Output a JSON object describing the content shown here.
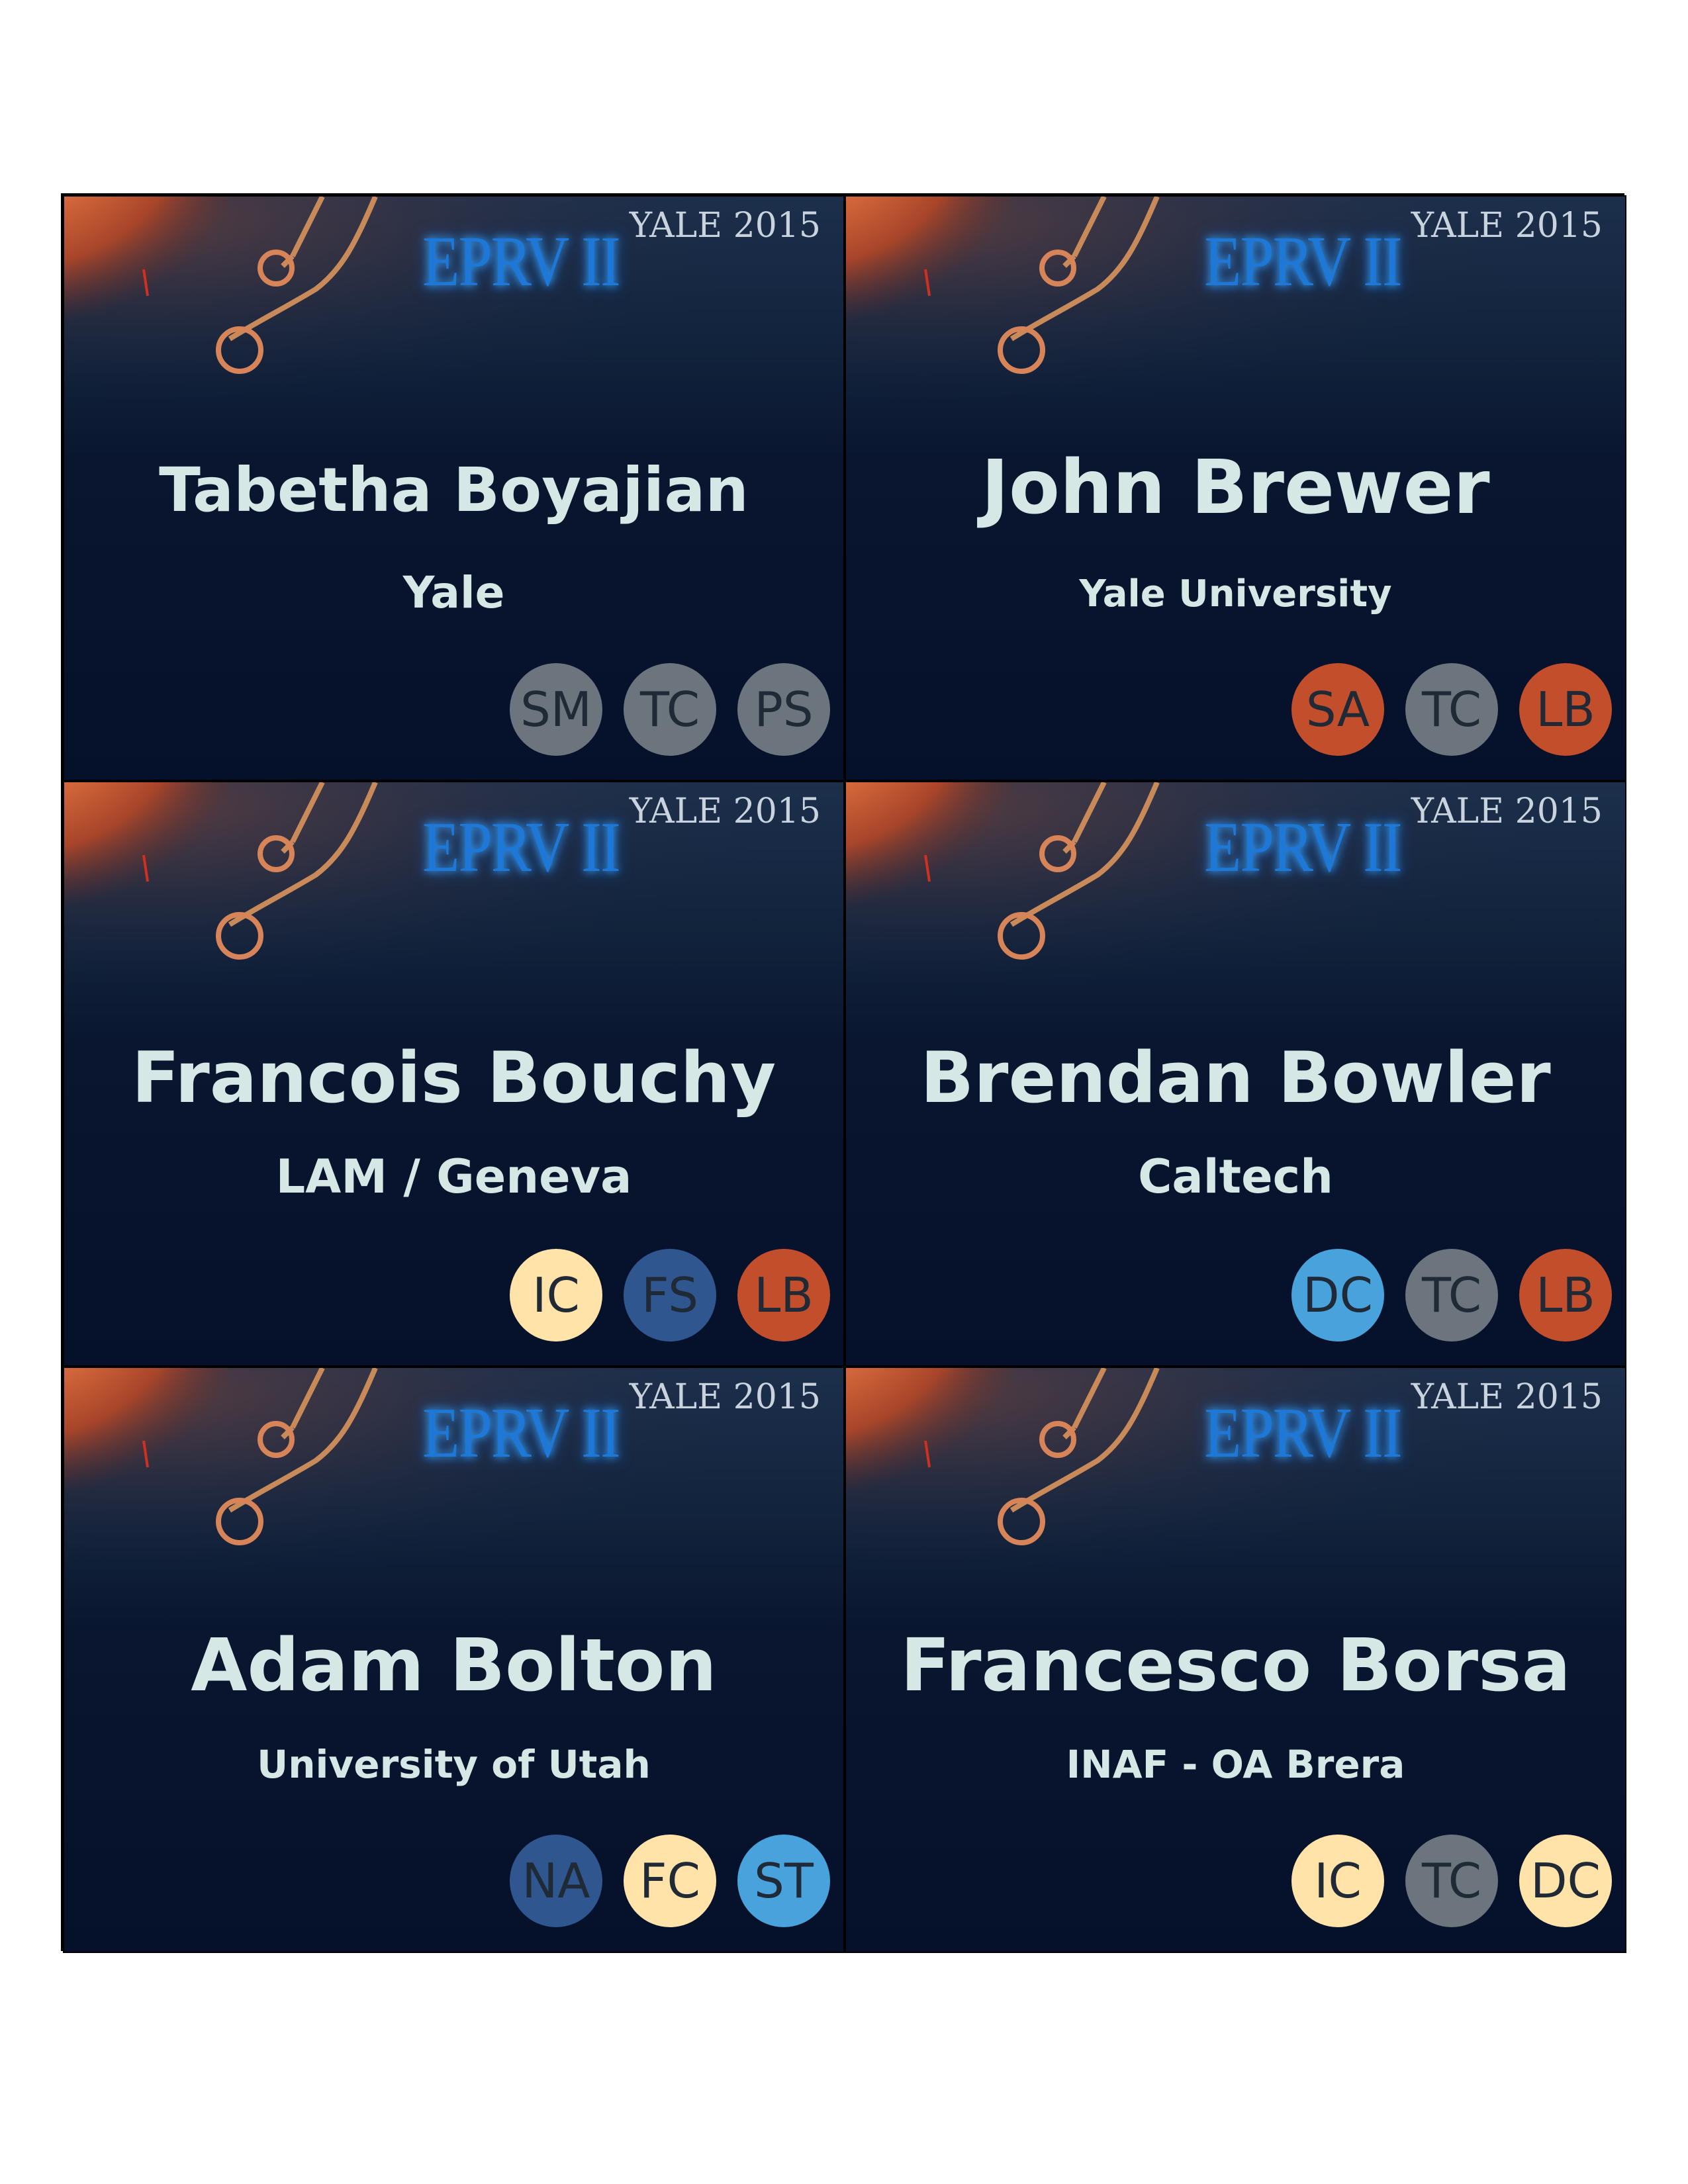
{
  "event": {
    "logo_text": "EPRV II",
    "year_text": "YALE 2015"
  },
  "colors": {
    "gray": "#6c757d",
    "orange": "#c24e2c",
    "cream": "#ffe3a9",
    "navy": "#2f568f",
    "sky": "#48a2dc"
  },
  "badges": [
    {
      "name": "Tabetha Boyajian",
      "affiliation": "Yale",
      "tags": [
        {
          "text": "SM",
          "color": "#6c757d"
        },
        {
          "text": "TC",
          "color": "#6c757d"
        },
        {
          "text": "PS",
          "color": "#6c757d"
        }
      ]
    },
    {
      "name": "John Brewer",
      "affiliation": "Yale University",
      "tags": [
        {
          "text": "SA",
          "color": "#c24e2c"
        },
        {
          "text": "TC",
          "color": "#6c757d"
        },
        {
          "text": "LB",
          "color": "#c24e2c"
        }
      ]
    },
    {
      "name": "Francois Bouchy",
      "affiliation": "LAM / Geneva",
      "tags": [
        {
          "text": "IC",
          "color": "#ffe3a9"
        },
        {
          "text": "FS",
          "color": "#2f568f"
        },
        {
          "text": "LB",
          "color": "#c24e2c"
        }
      ]
    },
    {
      "name": "Brendan Bowler",
      "affiliation": "Caltech",
      "tags": [
        {
          "text": "DC",
          "color": "#48a2dc"
        },
        {
          "text": "TC",
          "color": "#6c757d"
        },
        {
          "text": "LB",
          "color": "#c24e2c"
        }
      ]
    },
    {
      "name": "Adam Bolton",
      "affiliation": "University of Utah",
      "tags": [
        {
          "text": "NA",
          "color": "#2f568f"
        },
        {
          "text": "FC",
          "color": "#ffe3a9"
        },
        {
          "text": "ST",
          "color": "#48a2dc"
        }
      ]
    },
    {
      "name": "Francesco Borsa",
      "affiliation": "INAF - OA Brera",
      "tags": [
        {
          "text": "IC",
          "color": "#ffe3a9"
        },
        {
          "text": "TC",
          "color": "#6c757d"
        },
        {
          "text": "DC",
          "color": "#ffe3a9"
        }
      ]
    }
  ]
}
